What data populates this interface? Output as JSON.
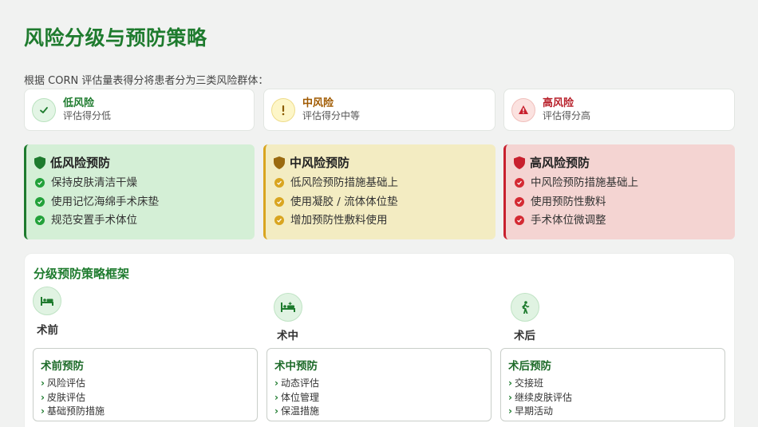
{
  "title": "风险分级与预防策略",
  "intro": "根据 CORN 评估量表得分将患者分为三类风险群体：",
  "levels": [
    {
      "name": "低风险",
      "desc": "评估得分低",
      "icon": "check-icon",
      "color": "#1e7b2e"
    },
    {
      "name": "中风险",
      "desc": "评估得分中等",
      "icon": "exclamation-icon",
      "color": "#a05a00"
    },
    {
      "name": "高风险",
      "desc": "评估得分高",
      "icon": "warning-triangle-icon",
      "color": "#b8202a"
    }
  ],
  "cards": [
    {
      "title": "低风险预防",
      "icon": "shield-icon",
      "items": [
        "保持皮肤清洁干燥",
        "使用记忆海绵手术床垫",
        "规范安置手术体位"
      ]
    },
    {
      "title": "中风险预防",
      "icon": "shield-icon",
      "items": [
        "低风险预防措施基础上",
        "使用凝胶 / 流体体位垫",
        "增加预防性敷料使用"
      ]
    },
    {
      "title": "高风险预防",
      "icon": "shield-icon",
      "items": [
        "中风险预防措施基础上",
        "使用预防性敷料",
        "手术体位微调整"
      ]
    }
  ],
  "framework": {
    "title": "分级预防策略框架",
    "phases": [
      {
        "label": "术前",
        "icon": "bed-icon"
      },
      {
        "label": "术中",
        "icon": "surgery-bed-icon"
      },
      {
        "label": "术后",
        "icon": "walking-person-icon"
      }
    ],
    "boxes": [
      {
        "title": "术前预防",
        "items": [
          "风险评估",
          "皮肤评估",
          "基础预防措施"
        ]
      },
      {
        "title": "术中预防",
        "items": [
          "动态评估",
          "体位管理",
          "保温措施"
        ]
      },
      {
        "title": "术后预防",
        "items": [
          "交接班",
          "继续皮肤评估",
          "早期活动"
        ]
      }
    ]
  },
  "colors": {
    "brand_green": "#1e7b2e",
    "low_bg": "#d4efd6",
    "mid_bg": "#f3ecc2",
    "high_bg": "#f4d4d2",
    "low_accent": "#1e7b2e",
    "mid_accent": "#d9a520",
    "high_accent": "#c8202e"
  }
}
